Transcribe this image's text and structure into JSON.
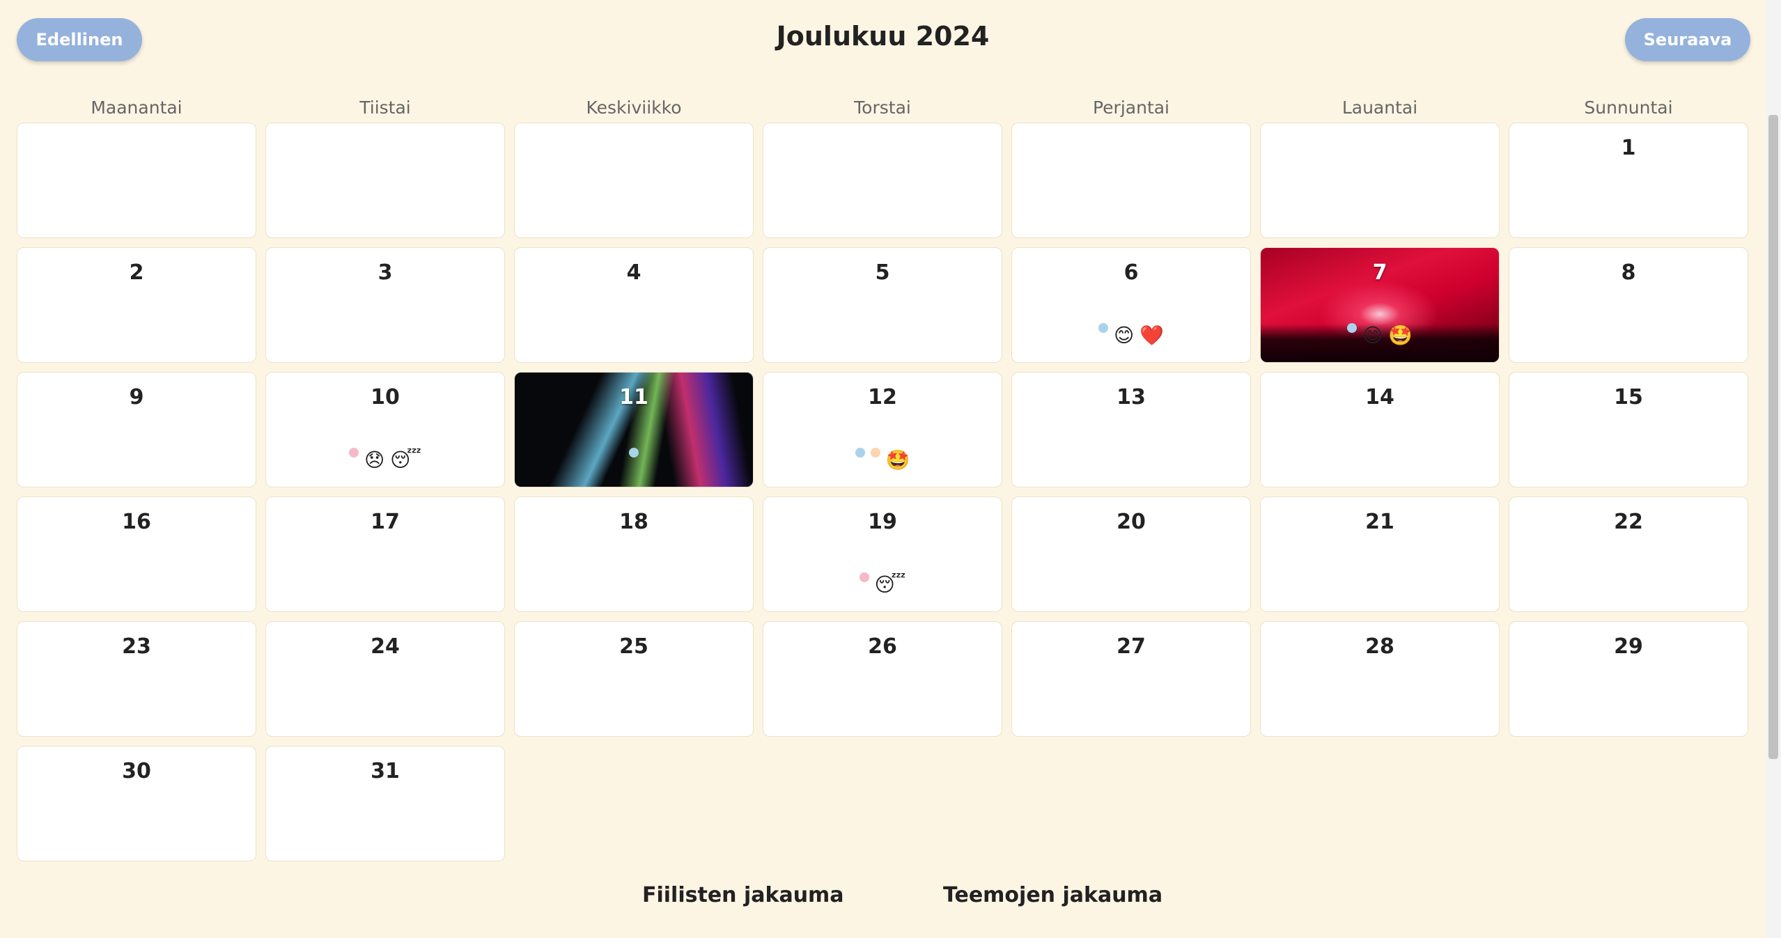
{
  "nav": {
    "prev_label": "Edellinen",
    "next_label": "Seuraava"
  },
  "title": "Joulukuu 2024",
  "weekdays": [
    "Maanantai",
    "Tiistai",
    "Keskiviikko",
    "Torstai",
    "Perjantai",
    "Lauantai",
    "Sunnuntai"
  ],
  "leading_blanks": 6,
  "days": [
    {
      "n": "1"
    },
    {
      "n": "2"
    },
    {
      "n": "3"
    },
    {
      "n": "4"
    },
    {
      "n": "5"
    },
    {
      "n": "6",
      "dots": [
        "#a9d3ea"
      ],
      "emojis": [
        "😊",
        "❤️"
      ]
    },
    {
      "n": "7",
      "photo": "concert-red",
      "dots": [
        "#a9d3ea"
      ],
      "emojis": [
        "😊",
        "🤩"
      ]
    },
    {
      "n": "8"
    },
    {
      "n": "9"
    },
    {
      "n": "10",
      "dots": [
        "#f7b9c6"
      ],
      "emojis": [
        "😞",
        "😴"
      ]
    },
    {
      "n": "11",
      "photo": "laser",
      "dots": [
        "#a9d3ea"
      ],
      "emojis": []
    },
    {
      "n": "12",
      "dots": [
        "#a9d3ea",
        "#fbd5b0"
      ],
      "emojis": [
        "🤩"
      ]
    },
    {
      "n": "13"
    },
    {
      "n": "14"
    },
    {
      "n": "15"
    },
    {
      "n": "16"
    },
    {
      "n": "17"
    },
    {
      "n": "18"
    },
    {
      "n": "19",
      "dots": [
        "#f7b9c6"
      ],
      "emojis": [
        "😴"
      ]
    },
    {
      "n": "20"
    },
    {
      "n": "21"
    },
    {
      "n": "22"
    },
    {
      "n": "23"
    },
    {
      "n": "24"
    },
    {
      "n": "25"
    },
    {
      "n": "26"
    },
    {
      "n": "27"
    },
    {
      "n": "28"
    },
    {
      "n": "29"
    },
    {
      "n": "30"
    },
    {
      "n": "31"
    }
  ],
  "charts": {
    "mood_title": "Fiilisten jakauma",
    "theme_title": "Teemojen jakauma"
  }
}
